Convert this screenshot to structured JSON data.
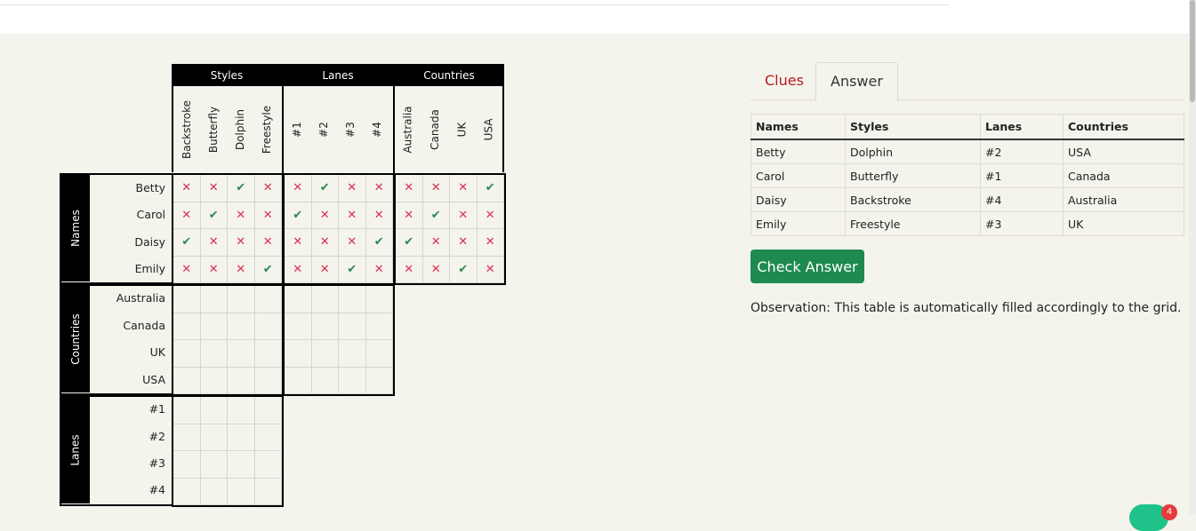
{
  "grid": {
    "top_groups": [
      "Styles",
      "Lanes",
      "Countries"
    ],
    "top_labels": [
      "Backstroke",
      "Butterfly",
      "Dolphin",
      "Freestyle",
      "#1",
      "#2",
      "#3",
      "#4",
      "Australia",
      "Canada",
      "UK",
      "USA"
    ],
    "side_groups": [
      "Names",
      "Countries",
      "Lanes"
    ],
    "names": [
      "Betty",
      "Carol",
      "Daisy",
      "Emily"
    ],
    "countries": [
      "Australia",
      "Canada",
      "UK",
      "USA"
    ],
    "lanes": [
      "#1",
      "#2",
      "#3",
      "#4"
    ],
    "marks": [
      [
        "x",
        "x",
        "v",
        "x",
        "x",
        "v",
        "x",
        "x",
        "x",
        "x",
        "x",
        "v"
      ],
      [
        "x",
        "v",
        "x",
        "x",
        "v",
        "x",
        "x",
        "x",
        "x",
        "v",
        "x",
        "x"
      ],
      [
        "v",
        "x",
        "x",
        "x",
        "x",
        "x",
        "x",
        "v",
        "v",
        "x",
        "x",
        "x"
      ],
      [
        "x",
        "x",
        "x",
        "v",
        "x",
        "x",
        "v",
        "x",
        "x",
        "x",
        "v",
        "x"
      ]
    ]
  },
  "tabs": {
    "clues": "Clues",
    "answer": "Answer"
  },
  "answer_table": {
    "headers": [
      "Names",
      "Styles",
      "Lanes",
      "Countries"
    ],
    "rows": [
      [
        "Betty",
        "Dolphin",
        "#2",
        "USA"
      ],
      [
        "Carol",
        "Butterfly",
        "#1",
        "Canada"
      ],
      [
        "Daisy",
        "Backstroke",
        "#4",
        "Australia"
      ],
      [
        "Emily",
        "Freestyle",
        "#3",
        "UK"
      ]
    ]
  },
  "check_button": "Check Answer",
  "observation": "Observation: This table is automatically filled accordingly to the grid.",
  "badge_count": "4",
  "colors": {
    "cross": "#d9304a",
    "check": "#2a8a4a",
    "button": "#1e8a4f",
    "clues_tab": "#b11e1e"
  }
}
